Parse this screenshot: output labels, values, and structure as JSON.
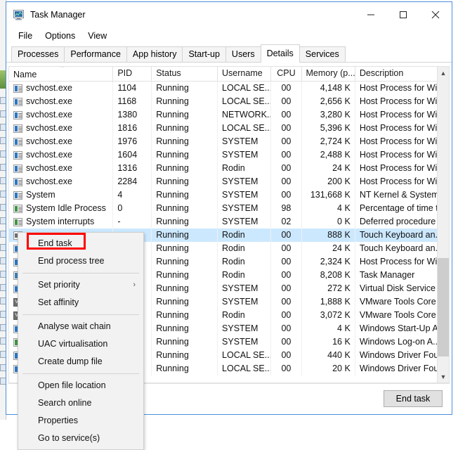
{
  "window": {
    "title": "Task Manager",
    "icon": "task-manager-icon",
    "controls": {
      "minimize": "minimize-icon",
      "maximize": "maximize-icon",
      "close": "close-icon"
    }
  },
  "menubar": {
    "items": [
      "File",
      "Options",
      "View"
    ]
  },
  "tabs": {
    "items": [
      "Processes",
      "Performance",
      "App history",
      "Start-up",
      "Users",
      "Details",
      "Services"
    ],
    "active": "Details"
  },
  "table": {
    "columns": [
      "Name",
      "PID",
      "Status",
      "Username",
      "CPU",
      "Memory (p...",
      "Description"
    ],
    "sort_column": "Name",
    "sort_direction": "ascending",
    "rows": [
      {
        "name": "svchost.exe",
        "icon": "process-icon",
        "pid": "1104",
        "status": "Running",
        "username": "LOCAL SE...",
        "cpu": "00",
        "memory": "4,148 K",
        "description": "Host Process for Wi...",
        "selected": false
      },
      {
        "name": "svchost.exe",
        "icon": "process-icon",
        "pid": "1168",
        "status": "Running",
        "username": "LOCAL SE...",
        "cpu": "00",
        "memory": "2,656 K",
        "description": "Host Process for Wi...",
        "selected": false
      },
      {
        "name": "svchost.exe",
        "icon": "process-icon",
        "pid": "1380",
        "status": "Running",
        "username": "NETWORK...",
        "cpu": "00",
        "memory": "3,280 K",
        "description": "Host Process for Wi...",
        "selected": false
      },
      {
        "name": "svchost.exe",
        "icon": "process-icon",
        "pid": "1816",
        "status": "Running",
        "username": "LOCAL SE...",
        "cpu": "00",
        "memory": "5,396 K",
        "description": "Host Process for Wi...",
        "selected": false
      },
      {
        "name": "svchost.exe",
        "icon": "process-icon",
        "pid": "1976",
        "status": "Running",
        "username": "SYSTEM",
        "cpu": "00",
        "memory": "2,724 K",
        "description": "Host Process for Wi...",
        "selected": false
      },
      {
        "name": "svchost.exe",
        "icon": "process-icon",
        "pid": "1604",
        "status": "Running",
        "username": "SYSTEM",
        "cpu": "00",
        "memory": "2,488 K",
        "description": "Host Process for Wi...",
        "selected": false
      },
      {
        "name": "svchost.exe",
        "icon": "process-icon",
        "pid": "1316",
        "status": "Running",
        "username": "Rodin",
        "cpu": "00",
        "memory": "24 K",
        "description": "Host Process for Wi...",
        "selected": false
      },
      {
        "name": "svchost.exe",
        "icon": "process-icon",
        "pid": "2284",
        "status": "Running",
        "username": "SYSTEM",
        "cpu": "00",
        "memory": "200 K",
        "description": "Host Process for Wi...",
        "selected": false
      },
      {
        "name": "System",
        "icon": "process-icon",
        "pid": "4",
        "status": "Running",
        "username": "SYSTEM",
        "cpu": "00",
        "memory": "131,668 K",
        "description": "NT Kernel & System",
        "selected": false
      },
      {
        "name": "System Idle Process",
        "icon": "system-icon",
        "pid": "0",
        "status": "Running",
        "username": "SYSTEM",
        "cpu": "98",
        "memory": "4 K",
        "description": "Percentage of time t...",
        "selected": false
      },
      {
        "name": "System interrupts",
        "icon": "system-icon",
        "pid": "-",
        "status": "Running",
        "username": "SYSTEM",
        "cpu": "02",
        "memory": "0 K",
        "description": "Deferred procedure ...",
        "selected": false
      },
      {
        "name": "",
        "icon": "keyboard-icon",
        "pid": "",
        "status": "Running",
        "username": "Rodin",
        "cpu": "00",
        "memory": "888 K",
        "description": "Touch Keyboard an...",
        "selected": true
      },
      {
        "name": "",
        "icon": "process-icon",
        "pid": "",
        "status": "Running",
        "username": "Rodin",
        "cpu": "00",
        "memory": "24 K",
        "description": "Touch Keyboard an...",
        "selected": false
      },
      {
        "name": "",
        "icon": "process-icon",
        "pid": "",
        "status": "Running",
        "username": "Rodin",
        "cpu": "00",
        "memory": "2,324 K",
        "description": "Host Process for Wi...",
        "selected": false
      },
      {
        "name": "",
        "icon": "taskmgr-icon",
        "pid": "",
        "status": "Running",
        "username": "Rodin",
        "cpu": "00",
        "memory": "8,208 K",
        "description": "Task Manager",
        "selected": false
      },
      {
        "name": "",
        "icon": "process-icon",
        "pid": "",
        "status": "Running",
        "username": "SYSTEM",
        "cpu": "00",
        "memory": "272 K",
        "description": "Virtual Disk Service",
        "selected": false
      },
      {
        "name": "",
        "icon": "vmware-icon",
        "pid": "",
        "status": "Running",
        "username": "SYSTEM",
        "cpu": "00",
        "memory": "1,888 K",
        "description": "VMware Tools Core ...",
        "selected": false
      },
      {
        "name": "",
        "icon": "vmware-icon",
        "pid": "",
        "status": "Running",
        "username": "Rodin",
        "cpu": "00",
        "memory": "3,072 K",
        "description": "VMware Tools Core ...",
        "selected": false
      },
      {
        "name": "",
        "icon": "process-icon",
        "pid": "",
        "status": "Running",
        "username": "SYSTEM",
        "cpu": "00",
        "memory": "4 K",
        "description": "Windows Start-Up A...",
        "selected": false
      },
      {
        "name": "",
        "icon": "system-icon",
        "pid": "",
        "status": "Running",
        "username": "SYSTEM",
        "cpu": "00",
        "memory": "16 K",
        "description": "Windows Log-on A...",
        "selected": false
      },
      {
        "name": "",
        "icon": "process-icon",
        "pid": "",
        "status": "Running",
        "username": "LOCAL SE...",
        "cpu": "00",
        "memory": "440 K",
        "description": "Windows Driver Fou...",
        "selected": false
      },
      {
        "name": "",
        "icon": "process-icon",
        "pid": "",
        "status": "Running",
        "username": "LOCAL SE...",
        "cpu": "00",
        "memory": "20 K",
        "description": "Windows Driver Fou...",
        "selected": false
      }
    ]
  },
  "context_menu": {
    "items": [
      {
        "label": "End task",
        "submenu": false,
        "separator_after": false
      },
      {
        "label": "End process tree",
        "submenu": false,
        "separator_after": true
      },
      {
        "label": "Set priority",
        "submenu": true,
        "separator_after": false
      },
      {
        "label": "Set affinity",
        "submenu": false,
        "separator_after": true
      },
      {
        "label": "Analyse wait chain",
        "submenu": false,
        "separator_after": false
      },
      {
        "label": "UAC virtualisation",
        "submenu": false,
        "separator_after": false
      },
      {
        "label": "Create dump file",
        "submenu": false,
        "separator_after": true
      },
      {
        "label": "Open file location",
        "submenu": false,
        "separator_after": false
      },
      {
        "label": "Search online",
        "submenu": false,
        "separator_after": false
      },
      {
        "label": "Properties",
        "submenu": false,
        "separator_after": false
      },
      {
        "label": "Go to service(s)",
        "submenu": false,
        "separator_after": false
      }
    ],
    "submenu_arrow": "chevron-right-icon"
  },
  "annotation": {
    "target": "End task",
    "color": "#ff0000"
  },
  "footer": {
    "end_task_label": "End task"
  },
  "scrollbar": {
    "up_arrow": "chevron-up-icon",
    "down_arrow": "chevron-down-icon"
  },
  "colors": {
    "window_border": "#4a90d9",
    "selection": "#cce8ff",
    "annotation": "#ff0000",
    "button_face": "#e1e1e1",
    "menu_bg": "#f2f2f2"
  }
}
